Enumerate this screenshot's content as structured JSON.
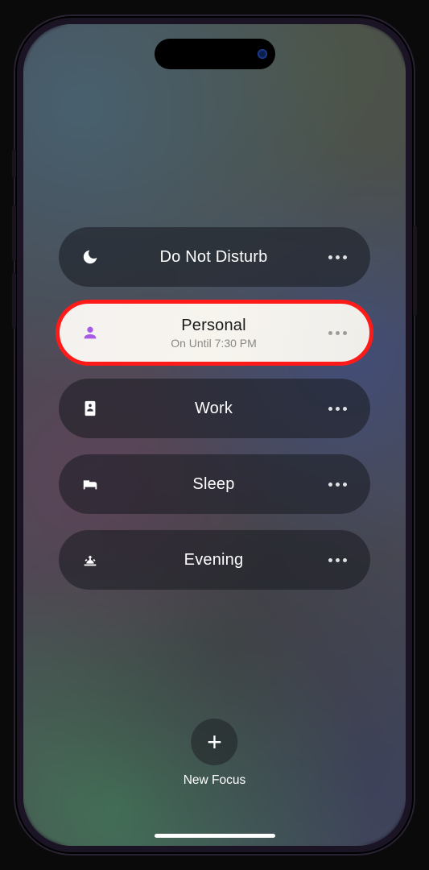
{
  "focus_modes": [
    {
      "id": "dnd",
      "label": "Do Not Disturb",
      "sublabel": "",
      "active": false,
      "icon": "moon-icon"
    },
    {
      "id": "personal",
      "label": "Personal",
      "sublabel": "On Until 7:30 PM",
      "active": true,
      "icon": "person-icon"
    },
    {
      "id": "work",
      "label": "Work",
      "sublabel": "",
      "active": false,
      "icon": "badge-icon"
    },
    {
      "id": "sleep",
      "label": "Sleep",
      "sublabel": "",
      "active": false,
      "icon": "bed-icon"
    },
    {
      "id": "evening",
      "label": "Evening",
      "sublabel": "",
      "active": false,
      "icon": "sunset-icon"
    }
  ],
  "new_focus": {
    "label": "New Focus"
  },
  "highlight_annotation": {
    "target": "personal",
    "color": "#ff1a1a"
  }
}
